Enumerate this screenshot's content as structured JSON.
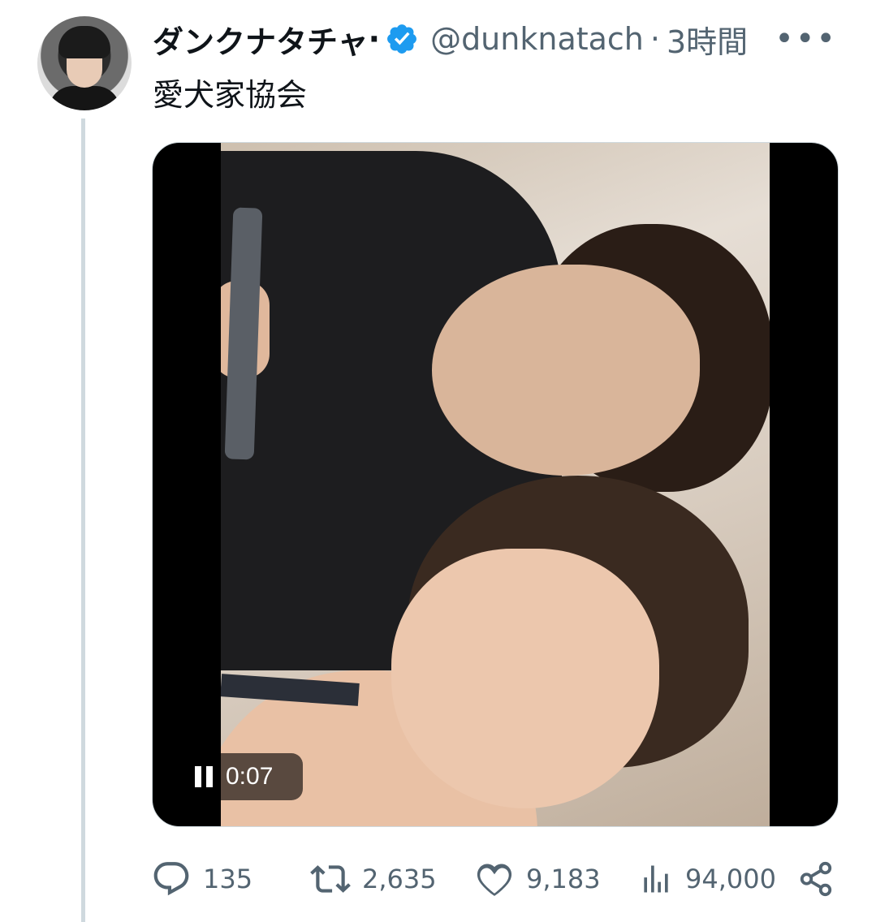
{
  "tweet": {
    "author_name": "ダンクナタチャ",
    "name_suffix": "·",
    "handle": "@dunknatach",
    "separator": "·",
    "time": "3時間",
    "more_label": "•••",
    "text": "愛犬家協会",
    "verified": true,
    "accent_color": "#1d9bf0"
  },
  "media": {
    "type": "video",
    "state": "playing",
    "duration": "0:07"
  },
  "actions": {
    "replies": "135",
    "retweets": "2,635",
    "likes": "9,183",
    "views": "94,000"
  },
  "icons": [
    "verified-badge-icon",
    "more-icon",
    "pause-icon",
    "reply-icon",
    "retweet-icon",
    "like-icon",
    "views-icon",
    "share-icon"
  ]
}
